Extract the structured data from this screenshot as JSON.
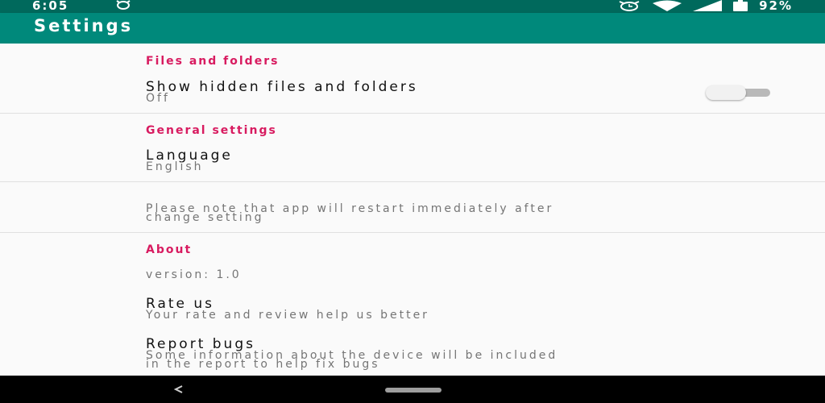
{
  "status_bar": {
    "time": "6:05",
    "battery_percent": "92%",
    "icons": [
      "alarm-icon",
      "alarm-clock-icon",
      "wifi-icon",
      "signal-icon",
      "battery-icon"
    ]
  },
  "app_bar": {
    "title": "Settings"
  },
  "sections": {
    "files": {
      "header": "Files and folders",
      "show_hidden": {
        "title": "Show hidden files and folders",
        "summary": "Off",
        "enabled": false
      }
    },
    "general": {
      "header": "General settings",
      "language": {
        "title": "Language",
        "summary": "English"
      },
      "note": {
        "line1": "Please note that app will restart immediately after",
        "line2": "change setting"
      }
    },
    "about": {
      "header": "About",
      "version": "version: 1.0",
      "rate": {
        "title": "Rate us",
        "summary": "Your rate and review help us better"
      },
      "report": {
        "title": "Report bugs",
        "summary_line1": "Some information about the device will be included",
        "summary_line2": "in the report to help fix bugs"
      }
    }
  },
  "colors": {
    "status_bar": "#00695c",
    "app_bar": "#00897b",
    "category_accent": "#d81b60",
    "background": "#fafafa"
  },
  "nav_bar": {
    "icons": [
      "back-icon",
      "home-pill"
    ]
  }
}
